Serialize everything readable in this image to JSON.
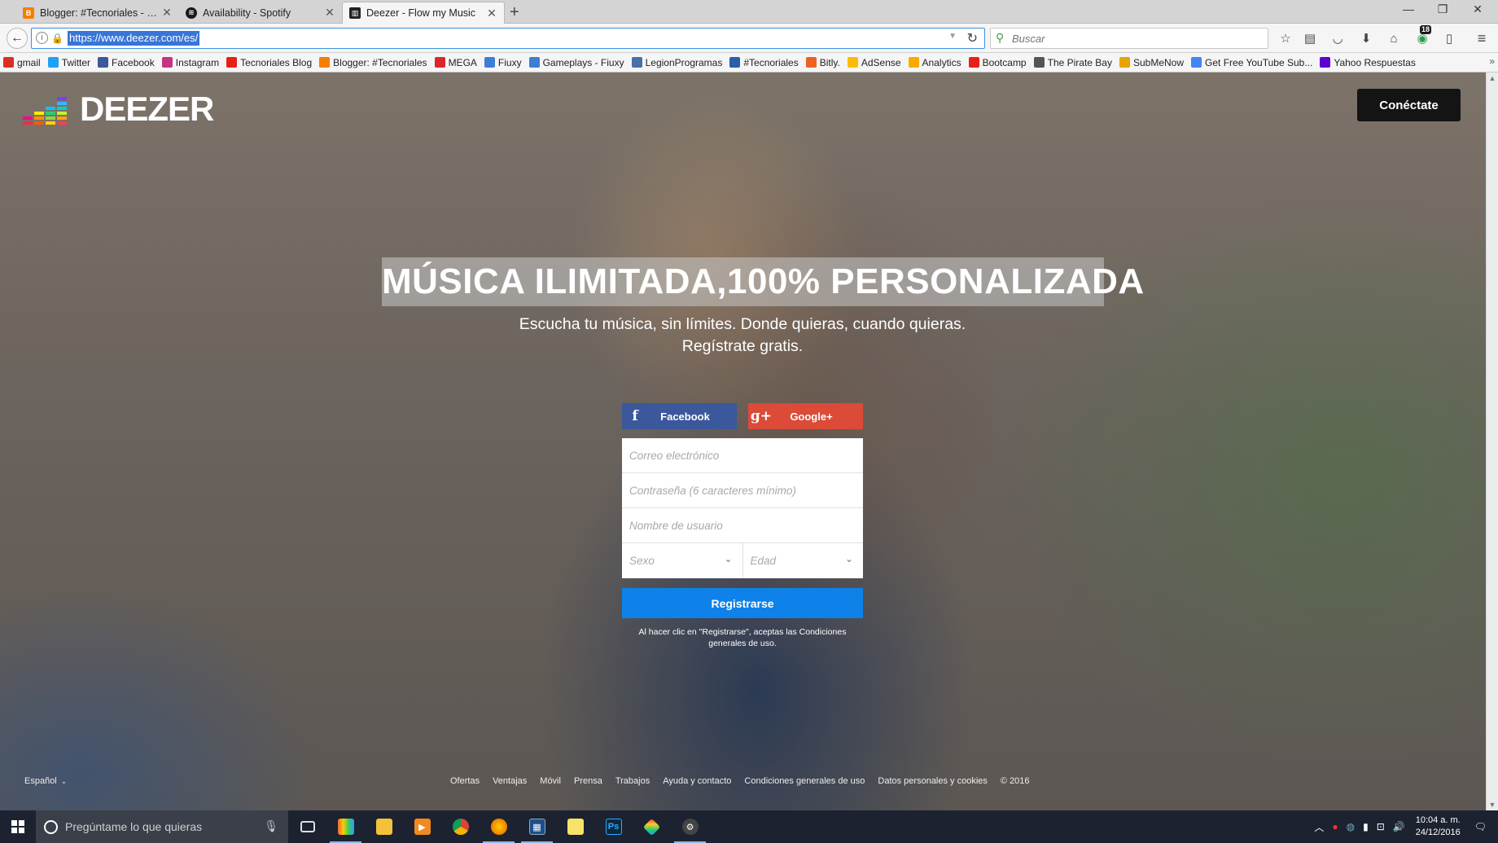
{
  "browser": {
    "tabs": [
      {
        "title": "Blogger: #Tecnoriales - Cr...",
        "favicon": "blogger-icon",
        "color": "#f57d00",
        "active": false
      },
      {
        "title": "Availability - Spotify",
        "favicon": "spotify-icon",
        "color": "#1a1a1a",
        "active": false
      },
      {
        "title": "Deezer - Flow my Music",
        "favicon": "deezer-icon",
        "color": "#222222",
        "active": true
      }
    ],
    "url": "https://www.deezer.com/es/",
    "search_placeholder": "Buscar",
    "download_badge": "18",
    "bookmarks": [
      {
        "label": "gmail",
        "icon": "gmail-icon",
        "color": "#d93025"
      },
      {
        "label": "Twitter",
        "icon": "twitter-icon",
        "color": "#1da1f2"
      },
      {
        "label": "Facebook",
        "icon": "facebook-icon",
        "color": "#3b5998"
      },
      {
        "label": "Instagram",
        "icon": "instagram-icon",
        "color": "#c13584"
      },
      {
        "label": "Tecnoriales Blog",
        "icon": "youtube-icon",
        "color": "#e62117"
      },
      {
        "label": "Blogger: #Tecnoriales",
        "icon": "blogger-icon",
        "color": "#f57d00"
      },
      {
        "label": "MEGA",
        "icon": "mega-icon",
        "color": "#d9272e"
      },
      {
        "label": "Fiuxy",
        "icon": "fiuxy-icon",
        "color": "#3d7fd6"
      },
      {
        "label": "Gameplays - Fiuxy",
        "icon": "fiuxy-icon",
        "color": "#3d7fd6"
      },
      {
        "label": "LegionProgramas",
        "icon": "legion-icon",
        "color": "#4a6fa5"
      },
      {
        "label": "#Tecnoriales",
        "icon": "tecnoriales-icon",
        "color": "#2b5fa8"
      },
      {
        "label": "Bitly.",
        "icon": "bitly-icon",
        "color": "#ee6123"
      },
      {
        "label": "AdSense",
        "icon": "adsense-icon",
        "color": "#fbbc05"
      },
      {
        "label": "Analytics",
        "icon": "analytics-icon",
        "color": "#f9ab00"
      },
      {
        "label": "Bootcamp",
        "icon": "youtube-icon",
        "color": "#e62117"
      },
      {
        "label": "The Pirate Bay",
        "icon": "pirate-ship-icon",
        "color": "#555555"
      },
      {
        "label": "SubMeNow",
        "icon": "submenow-icon",
        "color": "#e8a400"
      },
      {
        "label": "Get Free YouTube Sub...",
        "icon": "google-icon",
        "color": "#4285f4"
      },
      {
        "label": "Yahoo Respuestas",
        "icon": "yahoo-icon",
        "color": "#5f01d1"
      }
    ]
  },
  "page": {
    "brand": "DEEZER",
    "login_label": "Conéctate",
    "hero_title": "MÚSICA ILIMITADA,100% PERSONALIZADA",
    "hero_line1": "Escucha tu música, sin límites. Donde quieras, cuando quieras.",
    "hero_line2": "Regístrate gratis.",
    "facebook_label": "Facebook",
    "google_label": "Google+",
    "email_placeholder": "Correo electrónico",
    "password_placeholder": "Contraseña (6 caracteres mínimo)",
    "username_placeholder": "Nombre de usuario",
    "sex_placeholder": "Sexo",
    "age_placeholder": "Edad",
    "register_label": "Registrarse",
    "terms_text": "Al hacer clic en \"Registrarse\", aceptas las Condiciones generales de uso.",
    "language": "Español",
    "footer_links": [
      "Ofertas",
      "Ventajas",
      "Móvil",
      "Prensa",
      "Trabajos",
      "Ayuda y contacto",
      "Condiciones generales de uso",
      "Datos personales y cookies",
      "© 2016"
    ],
    "colors": {
      "facebook": "#3a589b",
      "google": "#dc4a38",
      "register": "#0e82e8"
    }
  },
  "taskbar": {
    "search_placeholder": "Pregúntame lo que quieras",
    "time": "10:04 a. m.",
    "date": "24/12/2016"
  }
}
